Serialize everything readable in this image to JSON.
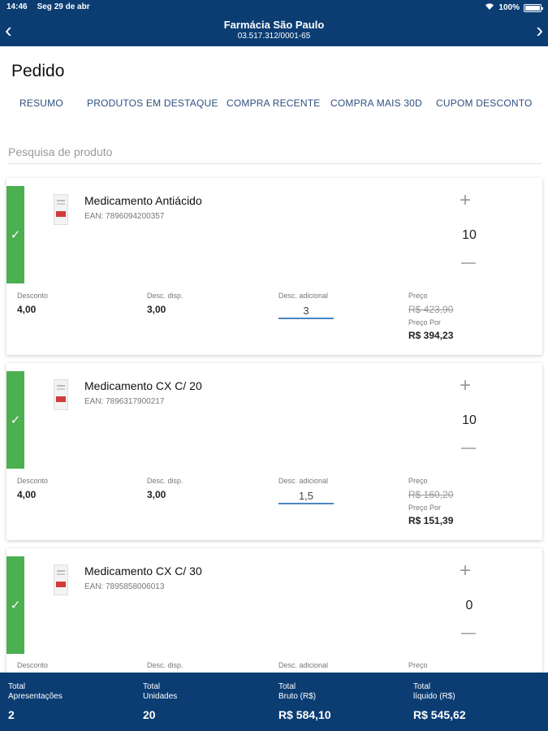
{
  "status": {
    "time": "14:46",
    "date": "Seg 29 de abr",
    "battery": "100%"
  },
  "header": {
    "title": "Farmácia São Paulo",
    "cnpj": "03.517.312/0001-65",
    "back_glyph": "‹",
    "forward_glyph": "›"
  },
  "page_title": "Pedido",
  "tabs": [
    {
      "label": "RESUMO"
    },
    {
      "label": "PRODUTOS EM DESTAQUE"
    },
    {
      "label": "COMPRA RECENTE"
    },
    {
      "label": "COMPRA MAIS 30D"
    },
    {
      "label": "CUPOM DESCONTO"
    }
  ],
  "search": {
    "placeholder": "Pesquisa de produto"
  },
  "labels": {
    "desconto": "Desconto",
    "desc_disp": "Desc. disp.",
    "desc_adicional": "Desc. adicional",
    "preco": "Preço",
    "preco_por": "Preço Por",
    "plus": "+",
    "check": "✓"
  },
  "products": [
    {
      "name": "Medicamento Antiácido",
      "ean": "EAN: 7896094200357",
      "qty": "10",
      "desconto": "4,00",
      "desc_disp": "3,00",
      "desc_adicional": "3",
      "preco": "R$ 423,90",
      "preco_por": "R$ 394,23"
    },
    {
      "name": "Medicamento CX C/ 20",
      "ean": "EAN: 7896317900217",
      "qty": "10",
      "desconto": "4,00",
      "desc_disp": "3,00",
      "desc_adicional": "1,5",
      "preco": "R$ 160,20",
      "preco_por": "R$ 151,39"
    },
    {
      "name": "Medicamento CX C/ 30",
      "ean": "EAN: 7895858006013",
      "qty": "0"
    }
  ],
  "footer": {
    "apresentacoes_label1": "Total",
    "apresentacoes_label2": "Apresentações",
    "apresentacoes": "2",
    "unidades_label1": "Total",
    "unidades_label2": "Unidades",
    "unidades": "20",
    "bruto_label1": "Total",
    "bruto_label2": "Bruto (R$)",
    "bruto": "R$ 584,10",
    "liquido_label1": "Total",
    "liquido_label2": "líquido (R$)",
    "liquido": "R$ 545,62"
  },
  "colors": {
    "header_bg": "#0b3d73",
    "check_green": "#4caf50",
    "tab_text": "#2c4f7f",
    "input_underline": "#4a86c5"
  }
}
